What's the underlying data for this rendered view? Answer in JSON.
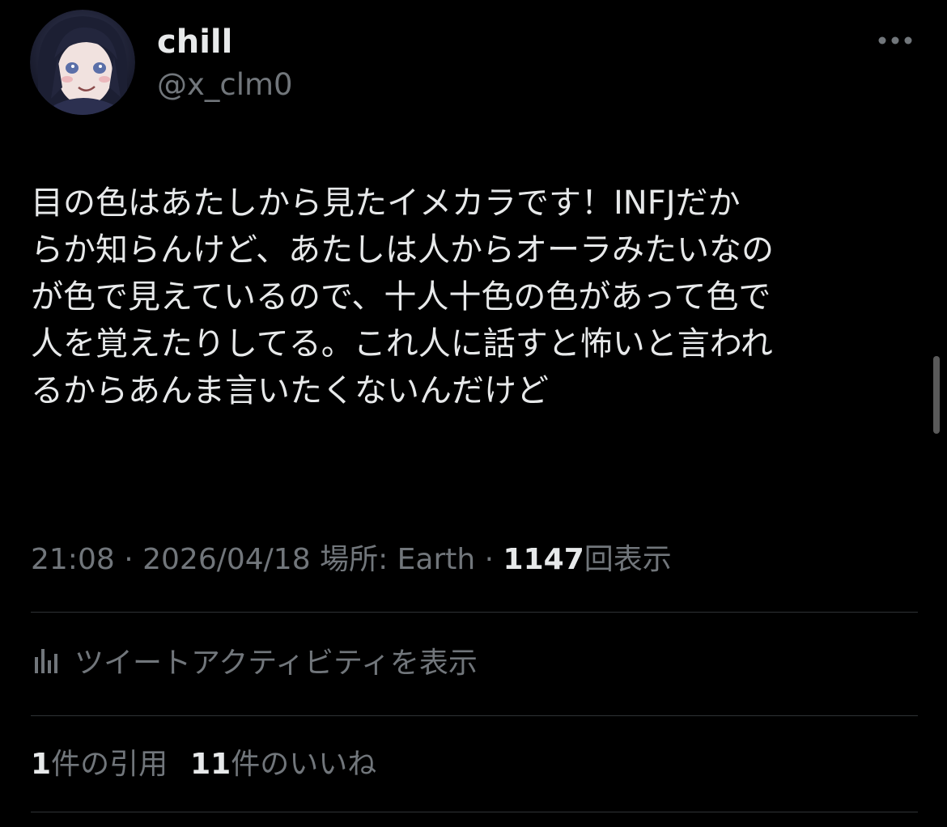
{
  "user": {
    "display_name": "chill",
    "handle": "@x_clm0",
    "avatar_icon": "profile-avatar"
  },
  "more_icon": "more-horizontal-icon",
  "tweet": {
    "lines": [
      "目の色はあたしから見たイメカラです！INFJだか",
      "らか知らんけど、あたしは人からオーラみたいなの",
      "が色で見えているので、十人十色の色があって色で",
      "人を覚えたりしてる。これ人に話すと怖いと言われ",
      "るからあんま言いたくないんだけど"
    ],
    "time": "21:08",
    "separator": "·",
    "date": "2026/04/18",
    "location_label": "場所: Earth",
    "views_count": "1147",
    "views_label": "回表示"
  },
  "activity": {
    "icon": "analytics-icon",
    "label": "ツイートアクティビティを表示"
  },
  "stats": {
    "quotes_count": "1",
    "quotes_label": "件の引用",
    "likes_count": "11",
    "likes_label": "件のいいね"
  },
  "colors": {
    "background": "#000000",
    "primary_text": "#e7e9ea",
    "secondary_text": "#71767b",
    "divider": "#2f3336"
  }
}
